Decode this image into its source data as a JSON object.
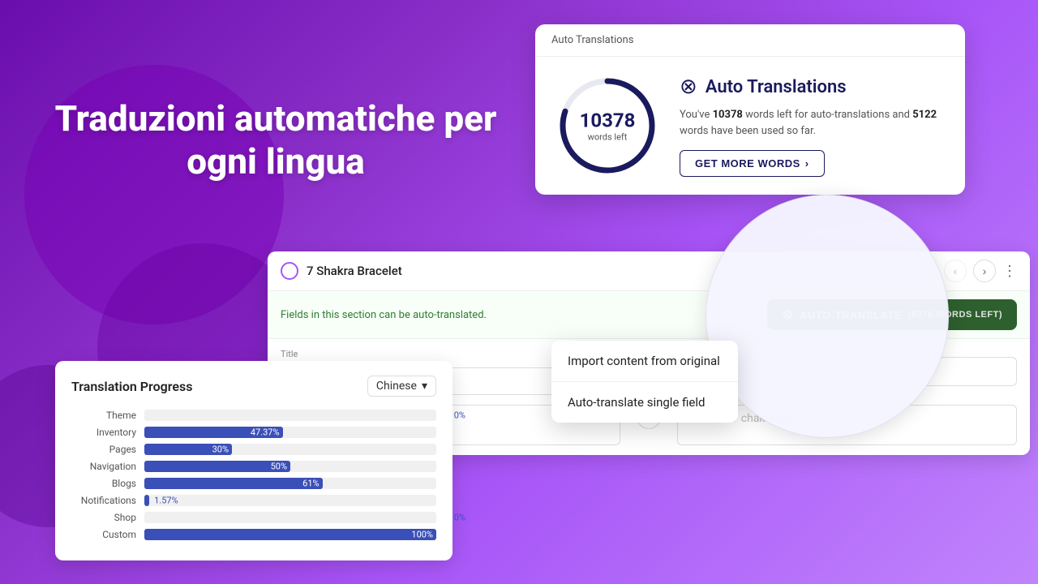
{
  "background": {
    "gradient_start": "#6a0dad",
    "gradient_end": "#c084fc"
  },
  "hero": {
    "line1": "Traduzioni automatiche per",
    "line2": "ogni lingua"
  },
  "auto_translations_card": {
    "header_label": "Auto Translations",
    "words_left_number": "10378",
    "words_left_label": "words left",
    "title": "Auto Translations",
    "description_part1": "You've ",
    "words_left_bold": "10378",
    "description_part2": " words left for auto-translations and ",
    "words_used_bold": "5122",
    "description_part3": " words have been used so far.",
    "get_more_label": "GET MORE WORDS"
  },
  "editor_panel": {
    "product_name": "7 Shakra Bracelet",
    "auto_translate_note": "Fields in this section can be auto-translated.",
    "auto_translate_button": "AUTO-TRANSLATE",
    "words_left_badge": "(5378 WORDS LEFT)",
    "title_label": "Title",
    "title_value": "7 Shakra Bracelet",
    "title_translated": "",
    "desc_value": "",
    "desc_translated": "Bracelet 7 chakras, c"
  },
  "dropdown": {
    "item1": "Import content from original",
    "item2": "Auto-translate single field"
  },
  "progress_card": {
    "title": "Translation Progress",
    "language": "Chinese",
    "bars": [
      {
        "label": "Theme",
        "pct": 0,
        "pct_text": "0%",
        "inside": false
      },
      {
        "label": "Inventory",
        "pct": 47.37,
        "pct_text": "47.37%",
        "inside": true
      },
      {
        "label": "Pages",
        "pct": 30,
        "pct_text": "30%",
        "inside": true
      },
      {
        "label": "Navigation",
        "pct": 50,
        "pct_text": "50%",
        "inside": true
      },
      {
        "label": "Blogs",
        "pct": 61,
        "pct_text": "61%",
        "inside": true
      },
      {
        "label": "Notifications",
        "pct": 1.57,
        "pct_text": "1.57%",
        "inside": false
      },
      {
        "label": "Shop",
        "pct": 0,
        "pct_text": "0%",
        "inside": false
      },
      {
        "label": "Custom",
        "pct": 100,
        "pct_text": "100%",
        "inside": true
      }
    ]
  }
}
